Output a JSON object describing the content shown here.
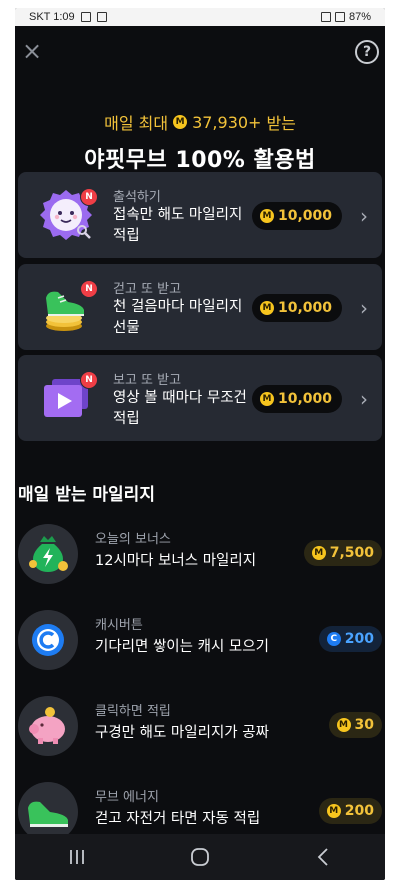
{
  "statusbar": {
    "carrier_time": "SKT 1:09",
    "battery": "87%"
  },
  "hero": {
    "sub_prefix": "매일 최대",
    "sub_amount": "37,930+",
    "sub_suffix": "받는",
    "title": "야핏무브 100% 활용법"
  },
  "cards": [
    {
      "category": "출석하기",
      "desc": "접속만 해도 마일리지 적립",
      "amount": "10,000",
      "badge": "N"
    },
    {
      "category": "걷고 또 받고",
      "desc": "천 걸음마다 마일리지 선물",
      "amount": "10,000",
      "badge": "N"
    },
    {
      "category": "보고 또 받고",
      "desc": "영상 볼 때마다 무조건 적립",
      "amount": "10,000",
      "badge": "N"
    }
  ],
  "section_title": "매일 받는 마일리지",
  "rows": [
    {
      "category": "오늘의 보너스",
      "desc": "12시마다 보너스 마일리지",
      "amount": "7,500",
      "coin": "M"
    },
    {
      "category": "캐시버튼",
      "desc": "기다리면 쌓이는 캐시 모으기",
      "amount": "200",
      "coin": "C"
    },
    {
      "category": "클릭하면 적립",
      "desc": "구경만 해도 마일리지가 공짜",
      "amount": "30",
      "coin": "M"
    },
    {
      "category": "무브 에너지",
      "desc": "걷고 자전거 타면 자동 적립",
      "amount": "200",
      "coin": "M"
    }
  ],
  "colors": {
    "accent": "#f2c23a",
    "card_bg": "#262a33",
    "badge_red": "#ef3e46",
    "cash_blue": "#1e7cf2"
  }
}
